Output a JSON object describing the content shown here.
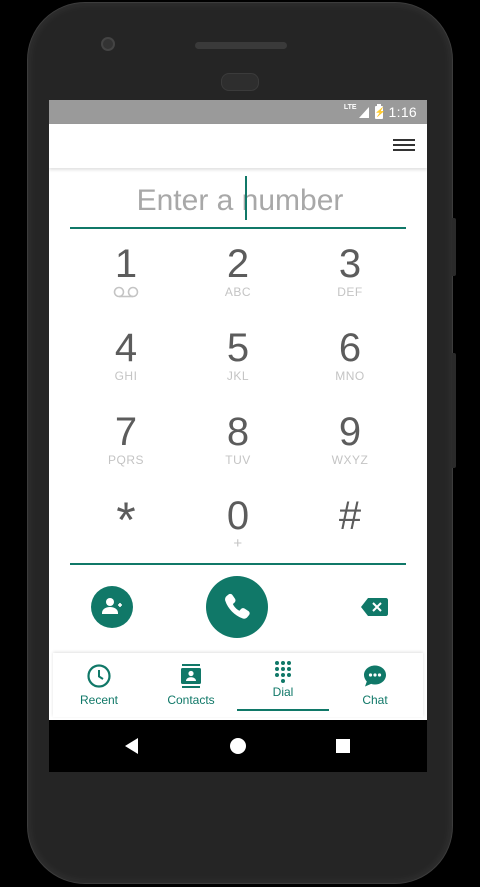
{
  "status": {
    "network": "LTE",
    "time": "1:16"
  },
  "dialer": {
    "placeholder": "Enter a number",
    "keys": [
      {
        "digit": "1",
        "letters": ""
      },
      {
        "digit": "2",
        "letters": "ABC"
      },
      {
        "digit": "3",
        "letters": "DEF"
      },
      {
        "digit": "4",
        "letters": "GHI"
      },
      {
        "digit": "5",
        "letters": "JKL"
      },
      {
        "digit": "6",
        "letters": "MNO"
      },
      {
        "digit": "7",
        "letters": "PQRS"
      },
      {
        "digit": "8",
        "letters": "TUV"
      },
      {
        "digit": "9",
        "letters": "WXYZ"
      },
      {
        "digit": "*",
        "letters": ""
      },
      {
        "digit": "0",
        "letters": "+"
      },
      {
        "digit": "#",
        "letters": ""
      }
    ]
  },
  "nav": {
    "items": [
      {
        "label": "Recent",
        "icon": "clock-icon"
      },
      {
        "label": "Contacts",
        "icon": "contacts-icon"
      },
      {
        "label": "Dial",
        "icon": "dialpad-icon",
        "selected": true
      },
      {
        "label": "Chat",
        "icon": "chat-icon"
      }
    ]
  },
  "colors": {
    "accent": "#107868",
    "statusbar": "#9a9a9a"
  }
}
